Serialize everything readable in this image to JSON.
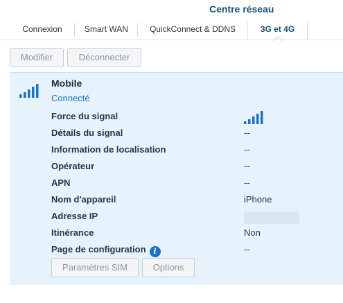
{
  "header": {
    "title": "Centre réseau"
  },
  "tabs": [
    {
      "label": "Connexion",
      "active": false
    },
    {
      "label": "Smart WAN",
      "active": false
    },
    {
      "label": "QuickConnect & DDNS",
      "active": false
    },
    {
      "label": "3G et 4G",
      "active": true
    }
  ],
  "toolbar": {
    "modify_label": "Modifier",
    "disconnect_label": "Déconnecter"
  },
  "device": {
    "name": "Mobile",
    "status": "Connecté",
    "icon": "signal-bars-icon",
    "signal_bars": 5
  },
  "details": [
    {
      "label": "Force du signal",
      "value": ""
    },
    {
      "label": "Détails du signal",
      "value": "--"
    },
    {
      "label": "Information de localisation",
      "value": "--"
    },
    {
      "label": "Opérateur",
      "value": "--"
    },
    {
      "label": "APN",
      "value": "--"
    },
    {
      "label": "Nom d'appareil",
      "value": "iPhone"
    },
    {
      "label": "Adresse IP",
      "value": ""
    },
    {
      "label": "Itinérance",
      "value": "Non"
    },
    {
      "label": "Page de configuration",
      "value": "--"
    }
  ],
  "actions": {
    "sim_label": "Paramètres SIM",
    "options_label": "Options"
  },
  "colors": {
    "accent": "#1a73c9",
    "panel_bg": "#e6f3fc",
    "title": "#1c4f7a"
  }
}
